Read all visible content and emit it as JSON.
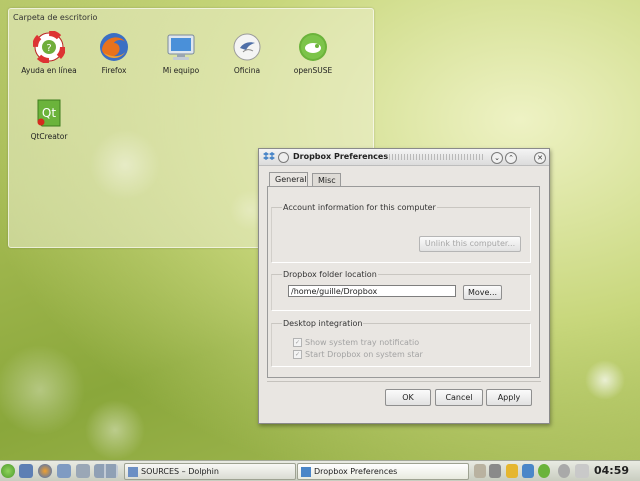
{
  "folderview": {
    "title": "Carpeta de escritorio",
    "icons": [
      {
        "label": "Ayuda en línea",
        "icon": "help-lifebuoy-icon"
      },
      {
        "label": "Firefox",
        "icon": "firefox-icon"
      },
      {
        "label": "Mi equipo",
        "icon": "computer-icon"
      },
      {
        "label": "Oficina",
        "icon": "office-icon"
      },
      {
        "label": "openSUSE",
        "icon": "opensuse-icon"
      },
      {
        "label": "QtCreator",
        "icon": "qtcreator-icon"
      }
    ]
  },
  "dialog": {
    "title": "Dropbox Preferences",
    "tabs": [
      {
        "label": "General",
        "active": true
      },
      {
        "label": "Misc",
        "active": false
      }
    ],
    "account": {
      "group_title": "Account information for this computer",
      "unlink_button": "Unlink this computer..."
    },
    "folder": {
      "group_title": "Dropbox folder location",
      "path_value": "/home/guille/Dropbox",
      "move_button": "Move..."
    },
    "integration": {
      "group_title": "Desktop integration",
      "option_tray": "Show system tray notificatio",
      "option_startup": "Start Dropbox on system star"
    },
    "buttons": {
      "ok": "OK",
      "cancel": "Cancel",
      "apply": "Apply"
    }
  },
  "taskbar": {
    "tasks": [
      {
        "label": "SOURCES – Dolphin"
      },
      {
        "label": "Dropbox Preferences",
        "active": true
      }
    ],
    "clock": "04:59"
  },
  "colors": {
    "desktop_green": "#9fb64d",
    "dialog_bg": "#e9e6e2",
    "opensuse_green": "#6bb33b",
    "firefox_orange": "#e8721c"
  }
}
